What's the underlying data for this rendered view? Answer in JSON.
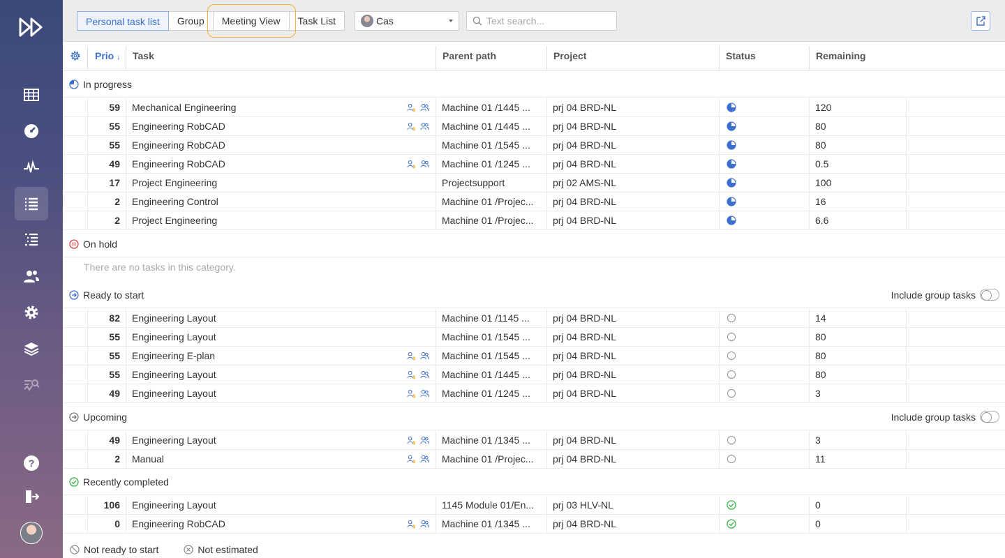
{
  "sidebar": {
    "items": [
      {
        "name": "logo",
        "icon": "fast-forward-icon"
      },
      {
        "name": "calendar",
        "icon": "calendar-grid-icon"
      },
      {
        "name": "dashboard",
        "icon": "gauge-icon"
      },
      {
        "name": "activity",
        "icon": "pulse-icon"
      },
      {
        "name": "task-list",
        "icon": "list-icon",
        "active": true
      },
      {
        "name": "planning",
        "icon": "tree-list-icon"
      },
      {
        "name": "users",
        "icon": "users-icon"
      },
      {
        "name": "settings",
        "icon": "gear-icon"
      },
      {
        "name": "layers",
        "icon": "layers-icon"
      },
      {
        "name": "analysis",
        "icon": "search-pulse-icon"
      },
      {
        "name": "help",
        "icon": "help-icon"
      },
      {
        "name": "logout",
        "icon": "logout-icon"
      }
    ]
  },
  "topbar": {
    "tabs": [
      "Personal task list",
      "Group",
      "Meeting View",
      "Task List"
    ],
    "active_tab": "Personal task list",
    "user_select": "Cas",
    "search_placeholder": "Text search..."
  },
  "columns": {
    "prio": "Prio",
    "task": "Task",
    "parent": "Parent path",
    "project": "Project",
    "status": "Status",
    "remaining": "Remaining"
  },
  "groups": {
    "in_progress": {
      "title": "In progress",
      "rows": [
        {
          "prio": "59",
          "color": "blue",
          "task": "Mechanical Engineering",
          "icons": true,
          "parent": "Machine 01 /1445 ...",
          "project": "prj 04 BRD-NL",
          "status": "in-progress",
          "remaining": "120"
        },
        {
          "prio": "55",
          "color": "blue",
          "task": "Engineering RobCAD",
          "icons": true,
          "parent": "Machine 01 /1445 ...",
          "project": "prj 04 BRD-NL",
          "status": "in-progress",
          "remaining": "80"
        },
        {
          "prio": "55",
          "color": "blue",
          "task": "Engineering RobCAD",
          "icons": false,
          "parent": "Machine 01 /1545 ...",
          "project": "prj 04 BRD-NL",
          "status": "in-progress",
          "remaining": "80"
        },
        {
          "prio": "49",
          "color": "blue",
          "task": "Engineering RobCAD",
          "icons": true,
          "parent": "Machine 01 /1245 ...",
          "project": "prj 04 BRD-NL",
          "status": "in-progress",
          "remaining": "0.5"
        },
        {
          "prio": "17",
          "color": "blue",
          "task": "Project Engineering",
          "icons": false,
          "parent": "Projectsupport",
          "project": "prj 02 AMS-NL",
          "status": "in-progress",
          "remaining": "100"
        },
        {
          "prio": "2",
          "color": "blue",
          "task": "Engineering Control",
          "icons": false,
          "parent": "Machine 01 /Projec...",
          "project": "prj 04 BRD-NL",
          "status": "in-progress",
          "remaining": "16"
        },
        {
          "prio": "2",
          "color": "blue",
          "task": "Project Engineering",
          "icons": false,
          "parent": "Machine 01 /Projec...",
          "project": "prj 04 BRD-NL",
          "status": "in-progress",
          "remaining": "6.6"
        }
      ]
    },
    "on_hold": {
      "title": "On hold",
      "empty_text": "There are no tasks in this category."
    },
    "ready": {
      "title": "Ready to start",
      "include_label": "Include group tasks",
      "rows": [
        {
          "prio": "82",
          "color": "orange",
          "task": "Engineering Layout",
          "icons": false,
          "parent": "Machine 01 /1145 ...",
          "project": "prj 04 BRD-NL",
          "status": "open",
          "remaining": "14"
        },
        {
          "prio": "55",
          "color": "blue",
          "task": "Engineering Layout",
          "icons": false,
          "parent": "Machine 01 /1545 ...",
          "project": "prj 04 BRD-NL",
          "status": "open",
          "remaining": "80"
        },
        {
          "prio": "55",
          "color": "blue",
          "task": "Engineering E-plan",
          "icons": true,
          "parent": "Machine 01 /1545 ...",
          "project": "prj 04 BRD-NL",
          "status": "open",
          "remaining": "80"
        },
        {
          "prio": "55",
          "color": "blue",
          "task": "Engineering Layout",
          "icons": true,
          "parent": "Machine 01 /1445 ...",
          "project": "prj 04 BRD-NL",
          "status": "open",
          "remaining": "80"
        },
        {
          "prio": "49",
          "color": "blue",
          "task": "Engineering Layout",
          "icons": true,
          "parent": "Machine 01 /1245 ...",
          "project": "prj 04 BRD-NL",
          "status": "open",
          "remaining": "3"
        }
      ]
    },
    "upcoming": {
      "title": "Upcoming",
      "include_label": "Include group tasks",
      "rows": [
        {
          "prio": "49",
          "color": "blue",
          "task": "Engineering Layout",
          "icons": true,
          "parent": "Machine 01 /1345 ...",
          "project": "prj 04 BRD-NL",
          "status": "open",
          "remaining": "3"
        },
        {
          "prio": "2",
          "color": "blue",
          "task": "Manual",
          "icons": true,
          "parent": "Machine 01 /Projec...",
          "project": "prj 04 BRD-NL",
          "status": "open",
          "remaining": "11"
        }
      ]
    },
    "completed": {
      "title": "Recently completed",
      "rows": [
        {
          "prio": "106",
          "color": "red",
          "task": "Engineering Layout",
          "icons": false,
          "parent": "1145 Module 01/En...",
          "project": "prj 03 HLV-NL",
          "status": "done",
          "remaining": "0"
        },
        {
          "prio": "0",
          "color": "blue",
          "task": "Engineering RobCAD",
          "icons": true,
          "parent": "Machine 01 /1345 ...",
          "project": "prj 04 BRD-NL",
          "status": "done",
          "remaining": "0"
        }
      ]
    }
  },
  "legend": {
    "not_ready": "Not ready to start",
    "not_estimated": "Not estimated"
  },
  "colors": {
    "prio_blue": "#2e8fe0",
    "prio_orange": "#f0a30a",
    "prio_red": "#e01e3c",
    "accent": "#3d6fcf",
    "highlight": "#f3b22f",
    "done": "#3ab54a",
    "hold": "#e04040"
  }
}
